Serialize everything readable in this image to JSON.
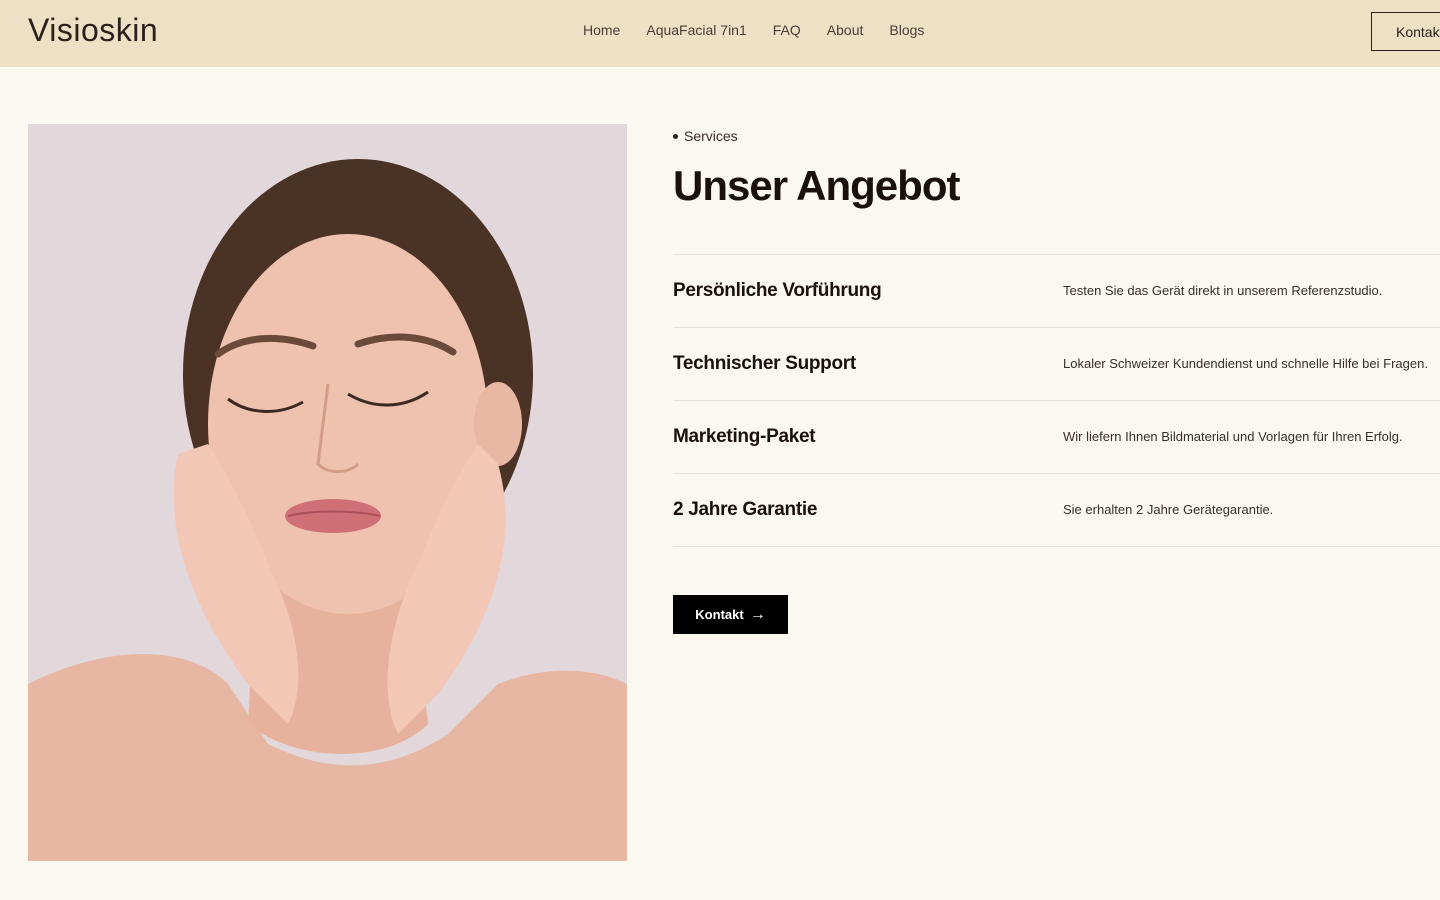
{
  "header": {
    "logo": "Visioskin",
    "nav": [
      "Home",
      "AquaFacial 7in1",
      "FAQ",
      "About",
      "Blogs"
    ],
    "contact_button": "Kontakt"
  },
  "section": {
    "eyebrow": "Services",
    "title": "Unser Angebot",
    "services": [
      {
        "name": "Persönliche Vorführung",
        "desc": "Testen Sie das Gerät direkt in unserem Referenzstudio."
      },
      {
        "name": "Technischer Support",
        "desc": "Lokaler Schweizer Kundendienst und schnelle Hilfe bei Fragen."
      },
      {
        "name": "Marketing-Paket",
        "desc": "Wir liefern Ihnen Bildmaterial und Vorlagen für Ihren Erfolg."
      },
      {
        "name": "2 Jahre Garantie",
        "desc": "Sie erhalten 2 Jahre Gerätegarantie."
      }
    ],
    "cta_label": "Kontakt",
    "cta_icon": "arrow-right-icon"
  },
  "colors": {
    "header_bg": "#ede0c4",
    "page_bg": "#fbf7f1",
    "button_bg": "#000000"
  }
}
